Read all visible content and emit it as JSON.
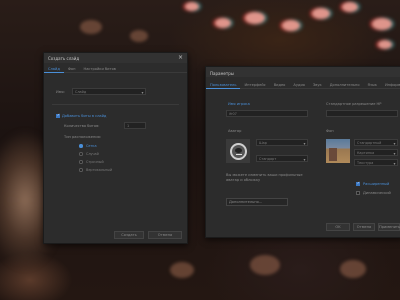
{
  "dialog_left": {
    "title": "Создать слайд",
    "tabs": [
      "Слайд",
      "Фон",
      "Настройки битов"
    ],
    "name_label": "Имя:",
    "name_value": "Слайд",
    "add_bits_label": "Добавить биты в слайд",
    "count_label": "Количество битов:",
    "count_value": "1",
    "layout_label": "Тип расположения:",
    "layout_options": [
      "Сетка",
      "Случай",
      "Строчный",
      "Вертикальный"
    ],
    "ok_label": "Создать",
    "cancel_label": "Отмена"
  },
  "dialog_right": {
    "title": "Параметры",
    "tabs": [
      "Пользователь",
      "Интерфейс",
      "Видео",
      "Аудио",
      "Звук",
      "Дополнительно",
      "Язык",
      "Информация"
    ],
    "nickname_label": "Имя игрока",
    "nickname_value": "ifr07",
    "avatar_label": "Аватар",
    "avatar_select_1": "Шар",
    "avatar_select_2": "Стандарт",
    "hint_text": "Вы можете изменить ваши профильные аватар и обложку",
    "hint_button": "Дополнительно...",
    "resolution_label": "Стандартное разрешение HP",
    "resolution_value": "",
    "cover_label": "Фон",
    "cover_select_1": "Стандартный",
    "cover_select_2": "Картинка",
    "cover_select_3": "Текстура",
    "checkbox_1": "Расширенный",
    "checkbox_2": "Динамический",
    "ok_label": "OK",
    "cancel_label": "Отмена",
    "apply_label": "Применить"
  },
  "colors": {
    "accent": "#4a8fd8",
    "window_bg": "#2c2c2c",
    "titlebar_bg": "#323232"
  }
}
